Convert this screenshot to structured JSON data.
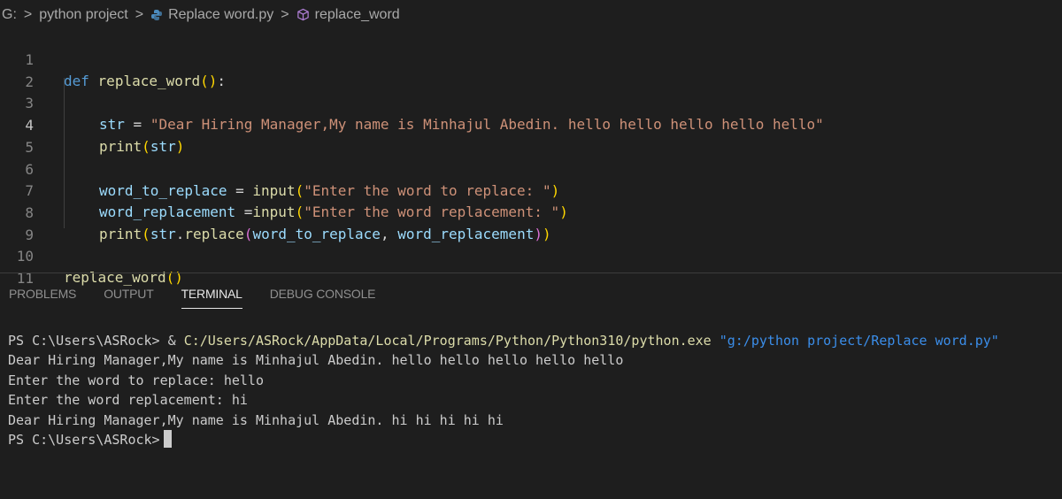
{
  "breadcrumb": {
    "drive": "G:",
    "folder": "python project",
    "file": "Replace word.py",
    "symbol": "replace_word"
  },
  "editor": {
    "line_numbers": [
      "1",
      "2",
      "3",
      "4",
      "5",
      "6",
      "7",
      "8",
      "9",
      "10",
      "11"
    ],
    "active_line": "4",
    "lines": {
      "l1": {
        "kw": "def",
        "fn": "replace_word",
        "open": "(",
        "close": ")",
        "colon": ":"
      },
      "l3": {
        "var": "str",
        "eq": " = ",
        "str": "\"Dear Hiring Manager,My name is Minhajul Abedin. hello hello hello hello hello\""
      },
      "l4": {
        "fn": "print",
        "open": "(",
        "var": "str",
        "close": ")"
      },
      "l6": {
        "var": "word_to_replace",
        "eq": " = ",
        "fn": "input",
        "open": "(",
        "str": "\"Enter the word to replace: \"",
        "close": ")"
      },
      "l7": {
        "var": "word_replacement",
        "eq": " =",
        "fn": "input",
        "open": "(",
        "str": "\"Enter the word replacement: \"",
        "close": ")"
      },
      "l8": {
        "fn": "print",
        "open": "(",
        "var": "str",
        "dot": ".",
        "method": "replace",
        "open2": "(",
        "arg1": "word_to_replace",
        "comma": ", ",
        "arg2": "word_replacement",
        "close2": ")",
        "close": ")"
      },
      "l10": {
        "fn": "replace_word",
        "open": "(",
        "close": ")"
      }
    }
  },
  "panel": {
    "tabs": [
      "PROBLEMS",
      "OUTPUT",
      "TERMINAL",
      "DEBUG CONSOLE"
    ],
    "active_tab": "TERMINAL"
  },
  "terminal": {
    "prompt1": "PS C:\\Users\\ASRock> ",
    "amp": "& ",
    "exe": "C:/Users/ASRock/AppData/Local/Programs/Python/Python310/python.exe",
    "script_arg": " \"g:/python project/Replace word.py\"",
    "out1": "Dear Hiring Manager,My name is Minhajul Abedin. hello hello hello hello hello",
    "out2": "Enter the word to replace: hello",
    "out3": "Enter the word replacement: hi",
    "out4": "Dear Hiring Manager,My name is Minhajul Abedin. hi hi hi hi hi",
    "prompt2": "PS C:\\Users\\ASRock>"
  },
  "colors": {
    "background": "#1e1e1e",
    "keyword": "#569cd6",
    "function": "#dcdcaa",
    "variable": "#9cdcfe",
    "string": "#ce9178",
    "terminal_arg": "#3b8eea"
  },
  "icons": {
    "file": "python-file-icon",
    "symbol": "cube-symbol-icon",
    "separator": "chevron-right-icon"
  }
}
